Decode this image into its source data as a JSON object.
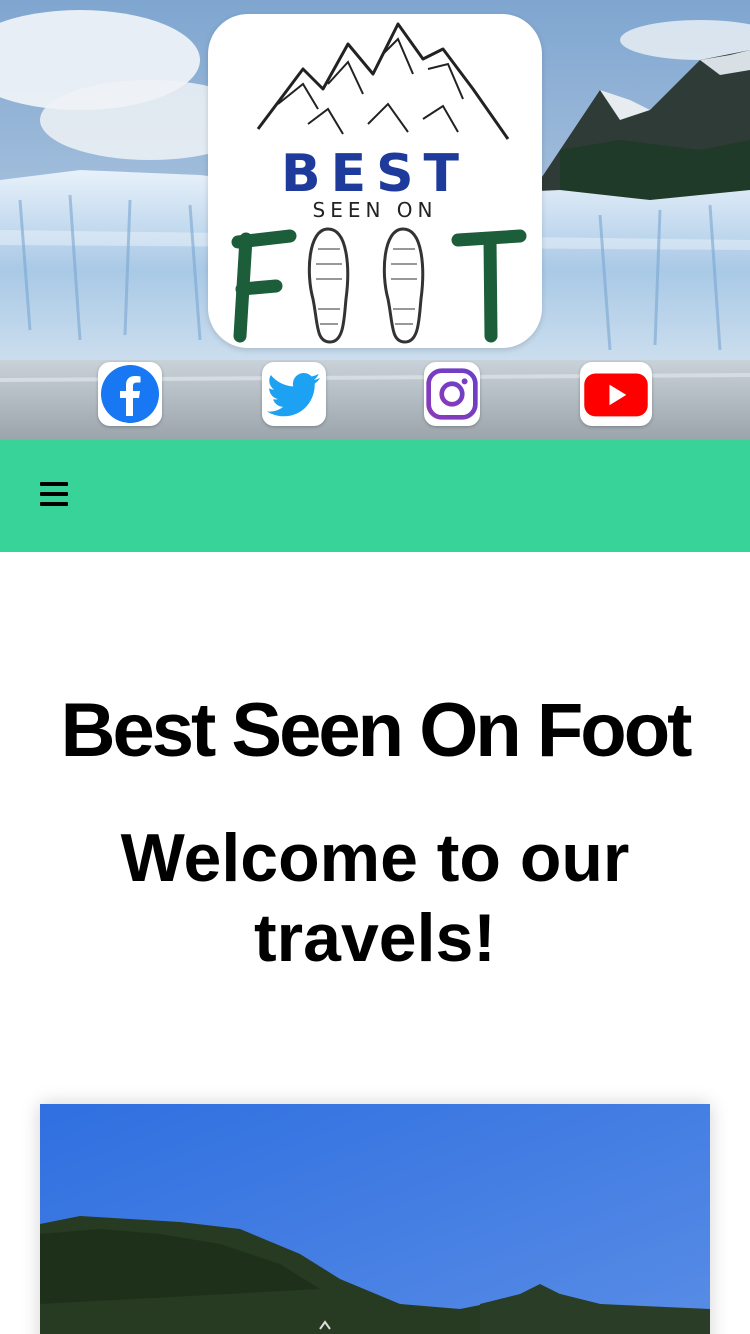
{
  "header": {
    "logo": {
      "line1": "BEST",
      "line2": "SEEN ON",
      "line3": "FOOT",
      "colors": {
        "best": "#1e3a9a",
        "foot": "#1d5e3a"
      }
    },
    "social": [
      {
        "name": "facebook",
        "icon": "facebook-icon",
        "color": "#1877f2"
      },
      {
        "name": "twitter",
        "icon": "twitter-icon",
        "color": "#1da1f2"
      },
      {
        "name": "instagram",
        "icon": "instagram-icon",
        "color": "#8a3ab9"
      },
      {
        "name": "youtube",
        "icon": "youtube-icon",
        "color": "#ff0000"
      }
    ]
  },
  "nav": {
    "menu_icon": "hamburger-menu-icon",
    "background": "#38d399"
  },
  "main": {
    "site_title": "Best Seen On Foot",
    "tagline": "Welcome to our travels!"
  }
}
